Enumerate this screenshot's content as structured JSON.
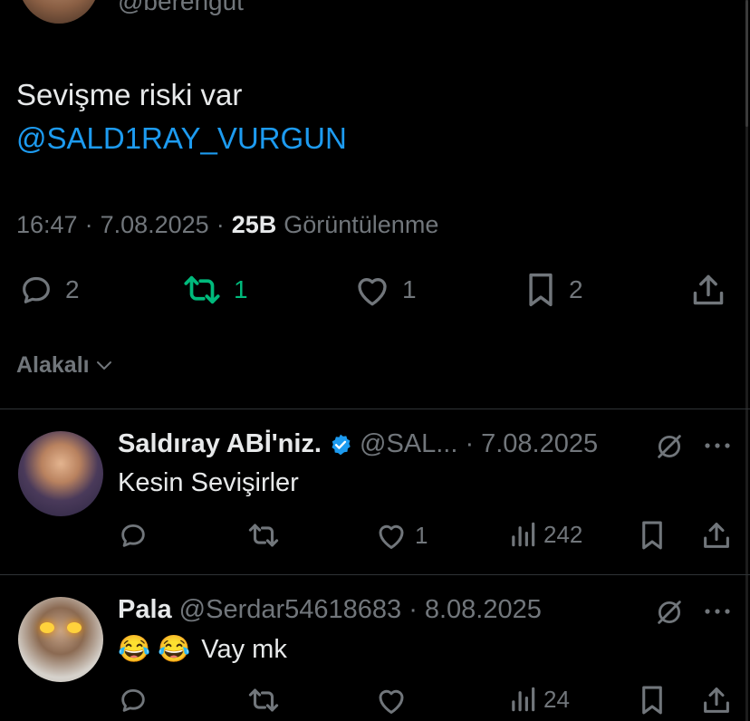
{
  "main_tweet": {
    "handle_partial": "@berengut",
    "text_line1": "Sevişme riski var",
    "mention": "@SALD1RAY_VURGUN",
    "time": "16:47",
    "date": "7.08.2025",
    "views_count": "25B",
    "views_label": "Görüntülenme",
    "stats": {
      "replies": "2",
      "retweets": "1",
      "likes": "1",
      "bookmarks": "2"
    }
  },
  "relevance": {
    "label": "Alakalı"
  },
  "replies": [
    {
      "name": "Saldıray ABİ'niz.",
      "handle": "@SAL...",
      "date": "7.08.2025",
      "text": "Kesin Sevişirler",
      "likes": "1",
      "views": "242"
    },
    {
      "name": "Pala",
      "handle": "@Serdar54618683",
      "date": "8.08.2025",
      "emoji": "😂 😂",
      "text": "Vay mk",
      "views": "24"
    }
  ],
  "colors": {
    "background": "#000000",
    "link": "#1d9bf0",
    "retweet_active": "#00ba7c",
    "muted": "#71767b",
    "verified": "#1d9bf0"
  },
  "icons": [
    "reply-icon",
    "retweet-icon",
    "like-icon",
    "bookmark-icon",
    "share-icon",
    "chevron-down-icon",
    "verified-badge-icon",
    "grok-icon",
    "more-icon",
    "views-icon"
  ]
}
